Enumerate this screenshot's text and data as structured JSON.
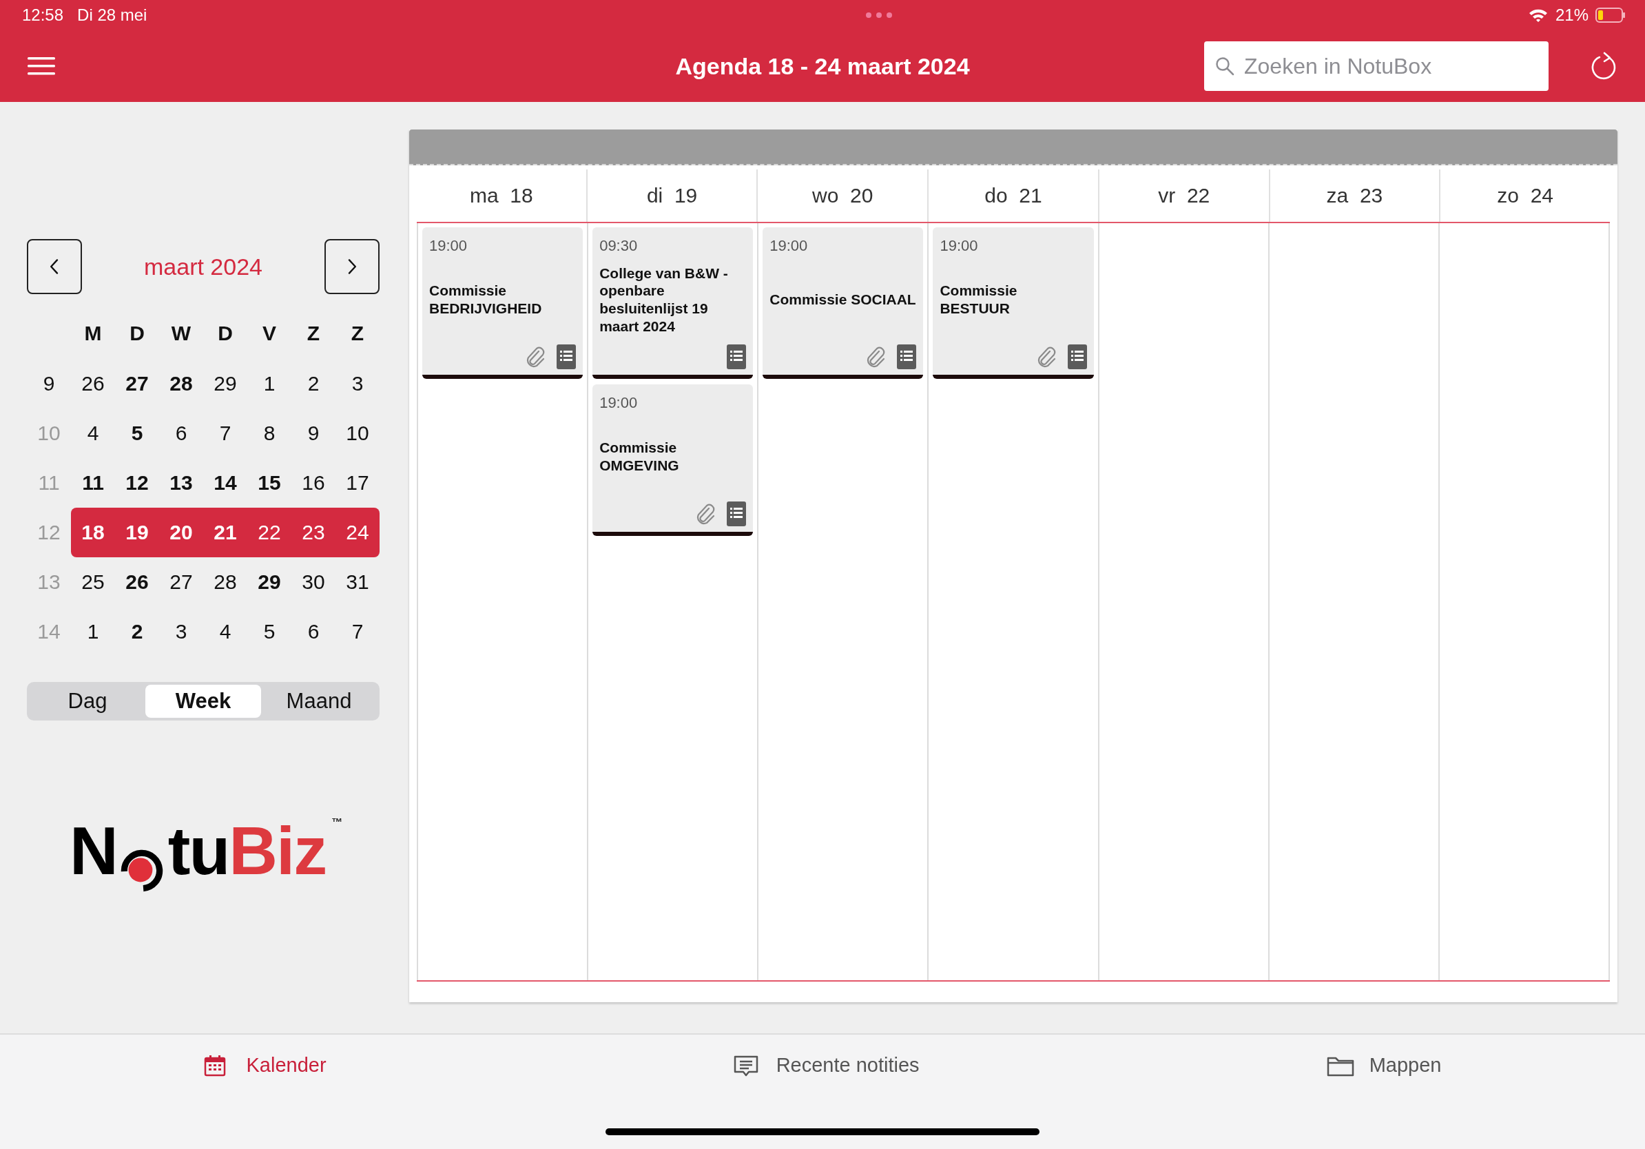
{
  "status_bar": {
    "time": "12:58",
    "date": "Di 28 mei",
    "battery": "21%"
  },
  "header": {
    "title": "Agenda 18 - 24 maart 2024",
    "search": {
      "placeholder": "Zoeken in NotuBox"
    }
  },
  "mini_calendar": {
    "month": "maart 2024",
    "weekdays": [
      "M",
      "D",
      "W",
      "D",
      "V",
      "Z",
      "Z"
    ],
    "weeks": [
      {
        "number": "9",
        "dim": false,
        "selected": false,
        "days": [
          {
            "label": "26",
            "bold": false
          },
          {
            "label": "27",
            "bold": true
          },
          {
            "label": "28",
            "bold": true
          },
          {
            "label": "29",
            "bold": false
          },
          {
            "label": "1",
            "bold": false
          },
          {
            "label": "2",
            "bold": false
          },
          {
            "label": "3",
            "bold": false
          }
        ]
      },
      {
        "number": "10",
        "dim": true,
        "selected": false,
        "days": [
          {
            "label": "4",
            "bold": false
          },
          {
            "label": "5",
            "bold": true
          },
          {
            "label": "6",
            "bold": false
          },
          {
            "label": "7",
            "bold": false
          },
          {
            "label": "8",
            "bold": false
          },
          {
            "label": "9",
            "bold": false
          },
          {
            "label": "10",
            "bold": false
          }
        ]
      },
      {
        "number": "11",
        "dim": true,
        "selected": false,
        "days": [
          {
            "label": "11",
            "bold": true
          },
          {
            "label": "12",
            "bold": true
          },
          {
            "label": "13",
            "bold": true
          },
          {
            "label": "14",
            "bold": true
          },
          {
            "label": "15",
            "bold": true
          },
          {
            "label": "16",
            "bold": false
          },
          {
            "label": "17",
            "bold": false
          }
        ]
      },
      {
        "number": "12",
        "dim": true,
        "selected": true,
        "days": [
          {
            "label": "18",
            "bold": true
          },
          {
            "label": "19",
            "bold": true
          },
          {
            "label": "20",
            "bold": true
          },
          {
            "label": "21",
            "bold": true
          },
          {
            "label": "22",
            "bold": false
          },
          {
            "label": "23",
            "bold": false
          },
          {
            "label": "24",
            "bold": false
          }
        ]
      },
      {
        "number": "13",
        "dim": true,
        "selected": false,
        "days": [
          {
            "label": "25",
            "bold": false
          },
          {
            "label": "26",
            "bold": true
          },
          {
            "label": "27",
            "bold": false
          },
          {
            "label": "28",
            "bold": false
          },
          {
            "label": "29",
            "bold": true
          },
          {
            "label": "30",
            "bold": false
          },
          {
            "label": "31",
            "bold": false
          }
        ]
      },
      {
        "number": "14",
        "dim": true,
        "selected": false,
        "days": [
          {
            "label": "1",
            "bold": false
          },
          {
            "label": "2",
            "bold": true
          },
          {
            "label": "3",
            "bold": false
          },
          {
            "label": "4",
            "bold": false
          },
          {
            "label": "5",
            "bold": false
          },
          {
            "label": "6",
            "bold": false
          },
          {
            "label": "7",
            "bold": false
          }
        ]
      }
    ],
    "view_modes": [
      {
        "label": "Dag",
        "selected": false
      },
      {
        "label": "Week",
        "selected": true
      },
      {
        "label": "Maand",
        "selected": false
      }
    ]
  },
  "logo": {
    "start": "N",
    "middle": "tu",
    "accent": "Biz",
    "mark": "™"
  },
  "week_view": {
    "days": [
      {
        "label": "ma  18",
        "events": [
          {
            "time": "19:00",
            "title": "Commissie BEDRIJVIGHEID",
            "attachment": true,
            "agenda": true
          }
        ]
      },
      {
        "label": "di  19",
        "events": [
          {
            "time": "09:30",
            "title": "College van B&W - openbare besluitenlijst 19 maart 2024",
            "attachment": false,
            "agenda": true
          },
          {
            "time": "19:00",
            "title": "Commissie OMGEVING",
            "attachment": true,
            "agenda": true
          }
        ]
      },
      {
        "label": "wo  20",
        "events": [
          {
            "time": "19:00",
            "title": "Commissie SOCIAAL",
            "attachment": true,
            "agenda": true
          }
        ]
      },
      {
        "label": "do  21",
        "events": [
          {
            "time": "19:00",
            "title": "Commissie BESTUUR",
            "attachment": true,
            "agenda": true
          }
        ]
      },
      {
        "label": "vr  22"
      },
      {
        "label": "za  23"
      },
      {
        "label": "zo  24"
      }
    ]
  },
  "tab_bar": [
    {
      "label": "Kalender",
      "kind": "calendar",
      "selected": true
    },
    {
      "label": "Recente notities",
      "kind": "notes",
      "selected": false
    },
    {
      "label": "Mappen",
      "kind": "folder",
      "selected": false
    }
  ]
}
